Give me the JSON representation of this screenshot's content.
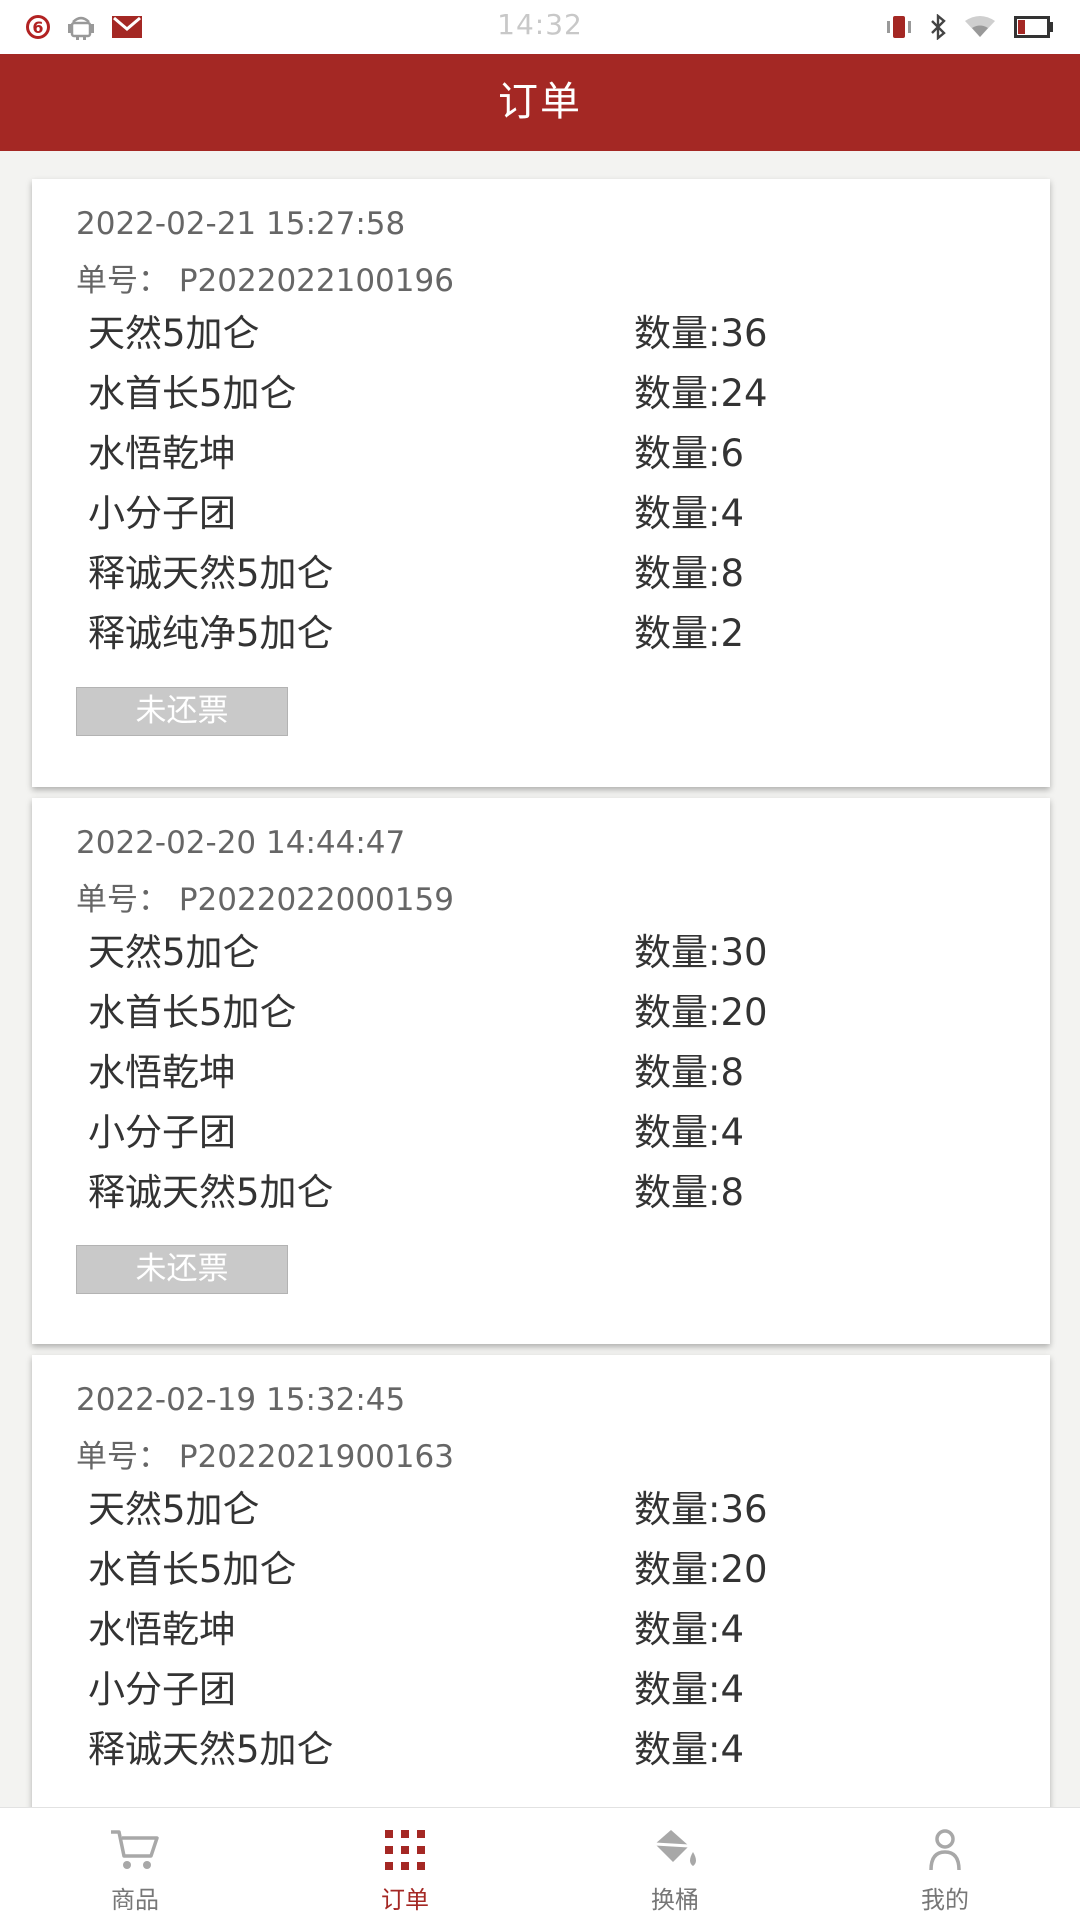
{
  "status_bar": {
    "time": "14:32",
    "notification_count": "6",
    "accent_color": "#b22222",
    "icons": [
      "android-icon",
      "mail-icon",
      "vibrate-icon",
      "bluetooth-icon",
      "wifi-icon",
      "battery-icon"
    ]
  },
  "header": {
    "title": "订单",
    "color": "#a42824"
  },
  "orders": [
    {
      "datetime": "2022-02-21 15:27:58",
      "order_no": "单号：  P2022022100196",
      "items": [
        {
          "name": "天然5加仑",
          "qty": "数量:36"
        },
        {
          "name": "水首长5加仑",
          "qty": "数量:24"
        },
        {
          "name": "水悟乾坤",
          "qty": "数量:6"
        },
        {
          "name": "小分子团",
          "qty": "数量:4"
        },
        {
          "name": "释诚天然5加仑",
          "qty": "数量:8"
        },
        {
          "name": "释诚纯净5加仑",
          "qty": "数量:2"
        }
      ],
      "status_label": "未还票"
    },
    {
      "datetime": "2022-02-20 14:44:47",
      "order_no": "单号：  P2022022000159",
      "items": [
        {
          "name": "天然5加仑",
          "qty": "数量:30"
        },
        {
          "name": "水首长5加仑",
          "qty": "数量:20"
        },
        {
          "name": "水悟乾坤",
          "qty": "数量:8"
        },
        {
          "name": "小分子团",
          "qty": "数量:4"
        },
        {
          "name": "释诚天然5加仑",
          "qty": "数量:8"
        }
      ],
      "status_label": "未还票"
    },
    {
      "datetime": "2022-02-19 15:32:45",
      "order_no": "单号：  P2022021900163",
      "items": [
        {
          "name": "天然5加仑",
          "qty": "数量:36"
        },
        {
          "name": "水首长5加仑",
          "qty": "数量:20"
        },
        {
          "name": "水悟乾坤",
          "qty": "数量:4"
        },
        {
          "name": "小分子团",
          "qty": "数量:4"
        },
        {
          "name": "释诚天然5加仑",
          "qty": "数量:4"
        }
      ]
    }
  ],
  "bottom_nav": {
    "items": [
      {
        "label": "商品",
        "icon": "cart-icon",
        "active": false
      },
      {
        "label": "订单",
        "icon": "grid-icon",
        "active": true
      },
      {
        "label": "换桶",
        "icon": "paint-bucket-icon",
        "active": false
      },
      {
        "label": "我的",
        "icon": "person-icon",
        "active": false
      }
    ],
    "active_color": "#a42824",
    "inactive_color": "#777777"
  }
}
